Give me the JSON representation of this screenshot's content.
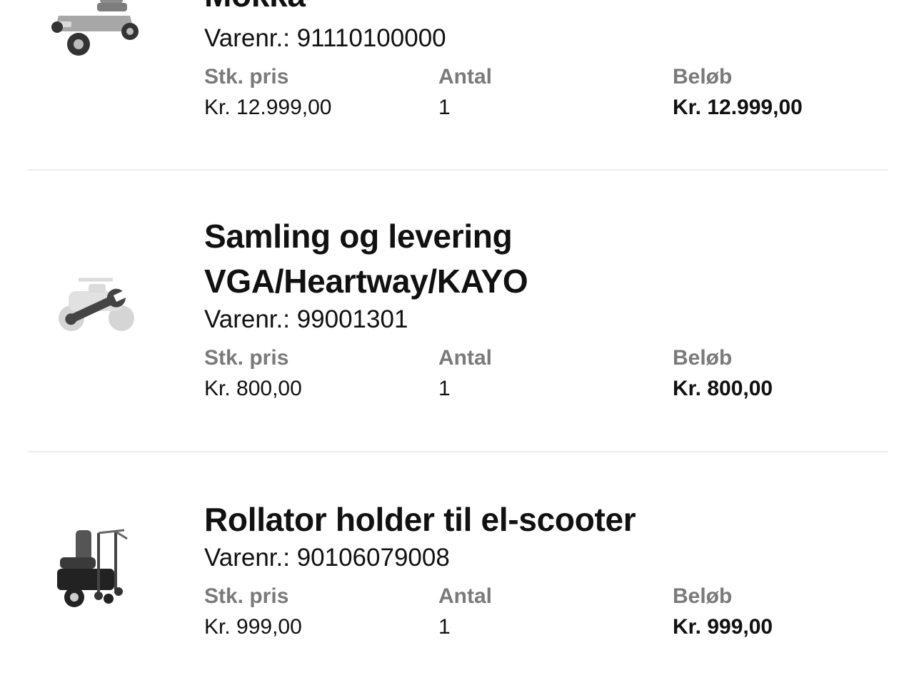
{
  "labels": {
    "sku_prefix": "Varenr.: ",
    "unit_price": "Stk. pris",
    "quantity": "Antal",
    "amount": "Beløb"
  },
  "items": [
    {
      "title": "Mokka",
      "sku_text": "Varenr.: 91110100000",
      "unit_price": "Kr. 12.999,00",
      "quantity": "1",
      "amount": "Kr. 12.999,00",
      "image_icon": "mobility-scooter-icon"
    },
    {
      "title_line1": "Samling og levering",
      "title_line2": "VGA/Heartway/KAYO",
      "sku_text": "Varenr.: 99001301",
      "unit_price": "Kr. 800,00",
      "quantity": "1",
      "amount": "Kr. 800,00",
      "image_icon": "assembly-wrench-icon"
    },
    {
      "title": "Rollator holder til el-scooter",
      "sku_text": "Varenr.: 90106079008",
      "unit_price": "Kr. 999,00",
      "quantity": "1",
      "amount": "Kr. 999,00",
      "image_icon": "rollator-holder-scooter-icon"
    }
  ],
  "colors": {
    "header_gray": "#7a7a7a",
    "divider": "#ececec",
    "text": "#111111"
  }
}
